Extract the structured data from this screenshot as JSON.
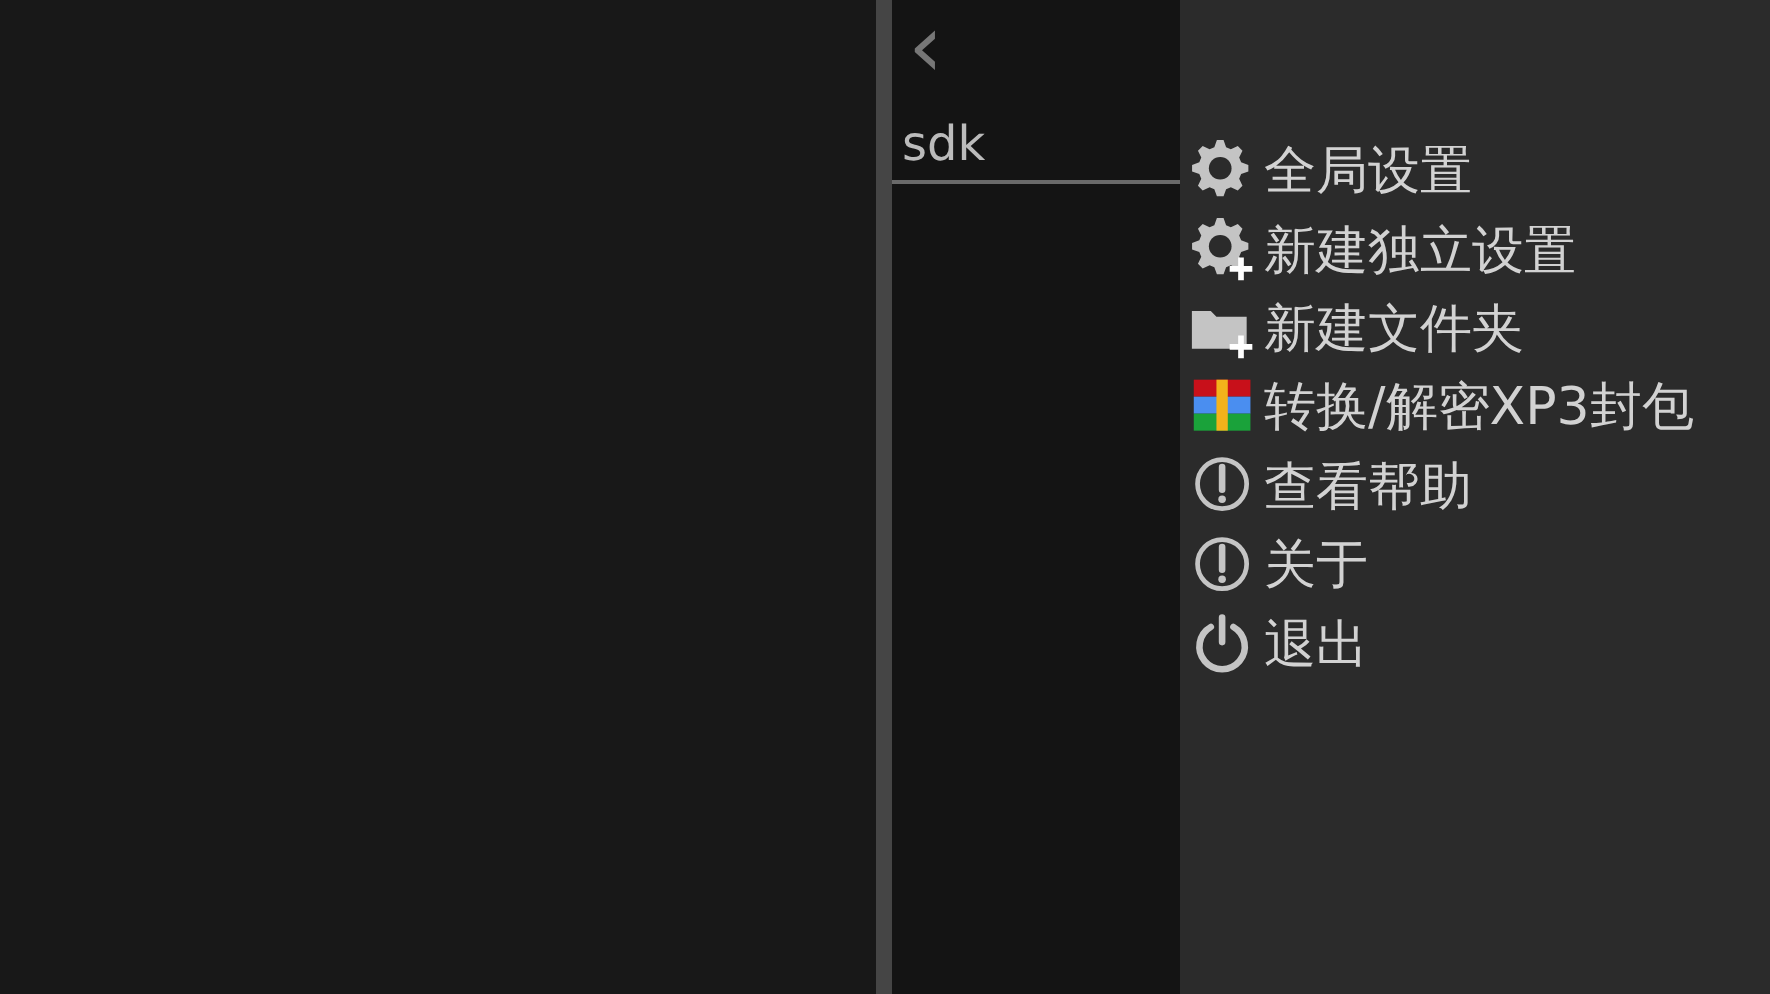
{
  "file_browser": {
    "back_button": "‹",
    "path": "sdk"
  },
  "menu": {
    "items": [
      {
        "kind": "gear",
        "label": "全局设置"
      },
      {
        "kind": "gear-plus",
        "label": "新建独立设置"
      },
      {
        "kind": "folder-plus",
        "label": "新建文件夹"
      },
      {
        "kind": "archive",
        "label": "转换/解密XP3封包"
      },
      {
        "kind": "info",
        "label": "查看帮助"
      },
      {
        "kind": "info",
        "label": "关于"
      },
      {
        "kind": "power",
        "label": "退出"
      }
    ]
  }
}
